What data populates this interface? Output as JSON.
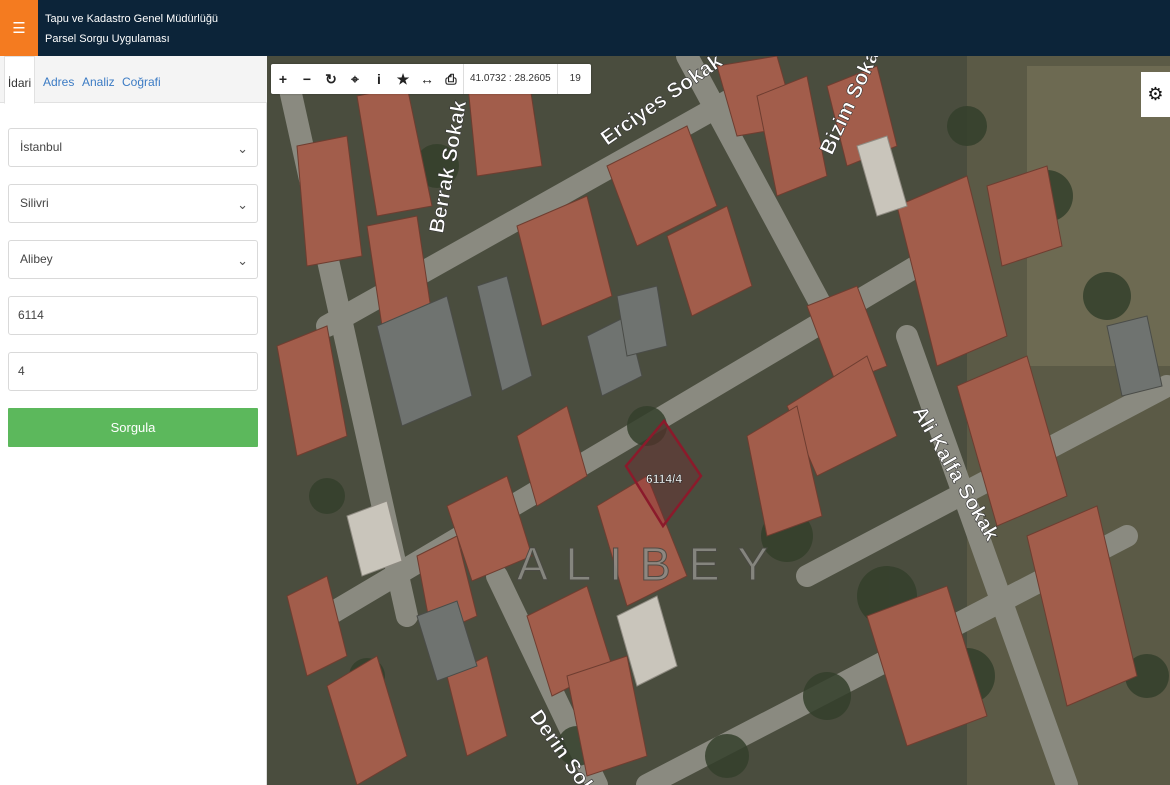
{
  "header": {
    "menu_icon": "☰",
    "org_name": "Tapu ve Kadastro Genel Müdürlüğü",
    "app_name": "Parsel Sorgu Uygulaması"
  },
  "sidebar": {
    "tabs": [
      "İdari",
      "Adres",
      "Analiz",
      "Coğrafi"
    ],
    "province": "İstanbul",
    "district": "Silivri",
    "neighborhood": "Alibey",
    "block_no": "6114",
    "parcel_no": "4",
    "submit_label": "Sorgula"
  },
  "toolbar": {
    "coords": "41.0732 : 28.2605",
    "zoom": "19"
  },
  "map": {
    "parcel_label": "6114/4",
    "area_label": "ALIBEY",
    "streets": [
      "Erciyes Sokak",
      "Bizim Sokak",
      "Berrak Sokak",
      "Ali Kalfa Sokak",
      "Derin Sokak"
    ]
  },
  "colors": {
    "header_bg": "#0c2439",
    "menu_accent": "#f47b20",
    "submit_green": "#5cb85c",
    "parcel_outline": "#8b1a2b"
  }
}
